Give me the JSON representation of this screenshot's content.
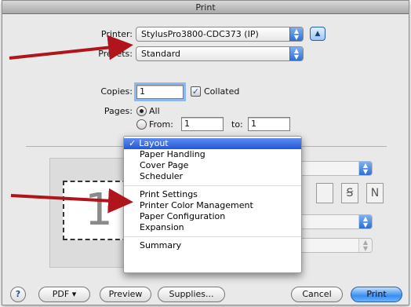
{
  "window": {
    "title": "Print"
  },
  "printer": {
    "label": "Printer:",
    "value": "StylusPro3800-CDC373 (IP)"
  },
  "presets": {
    "label": "Presets:",
    "value": "Standard"
  },
  "copies": {
    "label": "Copies:",
    "value": "1",
    "collated_label": "Collated",
    "collated_checked": true
  },
  "pages": {
    "label": "Pages:",
    "all_label": "All",
    "from_label": "From:",
    "from_value": "1",
    "to_label": "to:",
    "to_value": "1",
    "selected": "All"
  },
  "preview": {
    "page_number": "1"
  },
  "menu": {
    "items": [
      {
        "label": "Layout",
        "checked": true,
        "highlighted": true
      },
      {
        "label": "Paper Handling"
      },
      {
        "label": "Cover Page"
      },
      {
        "label": "Scheduler"
      },
      {
        "label": "Print Settings"
      },
      {
        "label": "Printer Color Management"
      },
      {
        "label": "Paper Configuration"
      },
      {
        "label": "Expansion"
      },
      {
        "label": "Summary"
      }
    ],
    "check_glyph": "✓"
  },
  "footer": {
    "help": "?",
    "pdf": "PDF ▾",
    "preview": "Preview",
    "supplies": "Supplies...",
    "cancel": "Cancel",
    "print": "Print"
  },
  "colors": {
    "annotation_arrow": "#b0141c",
    "accent": "#2d6fd1"
  }
}
